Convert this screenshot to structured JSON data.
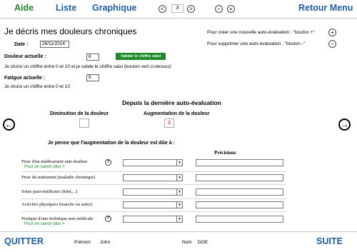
{
  "nav": {
    "aide": "Aide",
    "liste": "Liste",
    "graphique": "Graphique",
    "page_prev": "<",
    "page_number": "3",
    "page_next": ">",
    "page_minus": "−",
    "page_plus": "+",
    "retour_menu": "Retour Menu"
  },
  "header": {
    "title": "Je décris mes douleurs chroniques",
    "create_hint": "Pour créer une nouvelle auto-évaluation : \"bouton +\"",
    "delete_hint": "Pour supprimer une auto-évaluation : \"bouton -\"",
    "plus_symbol": "+",
    "minus_symbol": "−"
  },
  "form": {
    "date_label": "Date :",
    "date_value": "26/11/2014",
    "douleur_label": "Douleur actuelle :",
    "douleur_value": "6",
    "valider_button": "Valider le chiffre saisi",
    "douleur_hint": "Je choisi un chiffre entre 0 et 10 et je valide le chiffre saisi (bouton vert ci-dessus)",
    "fatigue_label": "Fatigue actuelle :",
    "fatigue_value": "5",
    "fatigue_hint": "Je choisi un chiffre entre 0 et 10"
  },
  "since": {
    "title": "Depuis la dernière auto-évaluation",
    "diminution_label": "Diminution de la douleur",
    "diminution_value": "",
    "augmentation_label": "Augmentation de la douleur",
    "augmentation_value": "3"
  },
  "arrows": {
    "prev": "←",
    "next": "→"
  },
  "causes": {
    "intro": "Je pense que l'augmentation de la douleur est dûe à :",
    "precisions_header": "Précisions",
    "help_symbol": "?",
    "select_arrow": "▾",
    "rows": [
      {
        "label": "Prise d'un médicament anti-douleur",
        "link": "Pour en savoir plus >"
      },
      {
        "label": "Prise du traitement (maladie chronique)",
        "link": ""
      },
      {
        "label": "Soins para-médicaux (kiné,...)",
        "link": ""
      },
      {
        "label": "Activités physiques (marche ou autre)",
        "link": ""
      },
      {
        "label": "Pratique d'une technique non médicale",
        "link": "Pour en savoir plus >"
      }
    ]
  },
  "footer": {
    "quitter": "QUITTER",
    "prenom_label": "Prénom",
    "prenom_value": "John",
    "nom_label": "Nom",
    "nom_value": "DOE",
    "suite": "SUITE"
  },
  "colors": {
    "green": "#1e8a2e",
    "blue": "#1f5fa8",
    "red": "#dd0000"
  }
}
